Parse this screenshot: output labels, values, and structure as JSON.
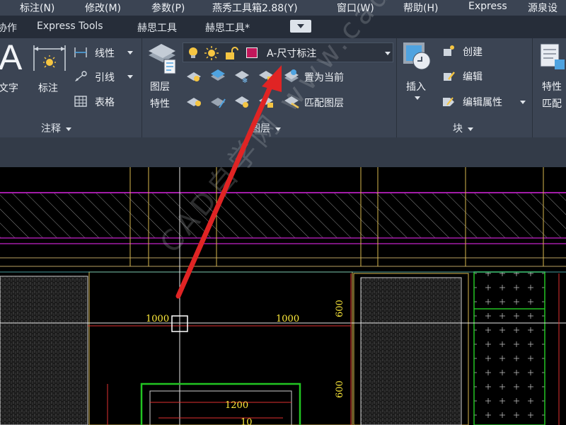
{
  "menubar": {
    "items": [
      "标注(N)",
      "修改(M)",
      "参数(P)",
      "燕秀工具箱2.88(Y)",
      "窗口(W)",
      "帮助(H)",
      "Express",
      "源泉设"
    ]
  },
  "ribbon_tabs": {
    "items": [
      "协作",
      "Express Tools",
      "赫思工具",
      "赫思工具*"
    ]
  },
  "annotation_panel": {
    "text_label": "文字",
    "dim_label": "标注",
    "linear_label": "线性",
    "leader_label": "引线",
    "table_label": "表格",
    "title": "注释"
  },
  "layers_panel": {
    "layer_props_label_1": "图层",
    "layer_props_label_2": "特性",
    "current_layer": "A-尺寸标注",
    "layer_color": "#c2185b",
    "set_current_label": "置为当前",
    "match_layer_label": "匹配图层",
    "title": "图层"
  },
  "block_panel": {
    "insert_label": "插入",
    "create_label": "创建",
    "edit_label": "编辑",
    "edit_attr_label": "编辑属性",
    "title": "块"
  },
  "properties_panel": {
    "label_1": "特性",
    "label_2": "匹配"
  },
  "drawing": {
    "dims": [
      "1000",
      "1000",
      "600",
      "600",
      "1200",
      "10"
    ],
    "watermark": "CAD自学网 www.cadzxw.com",
    "colors": {
      "yellow": "#d9b94e",
      "magenta": "#a21ca8",
      "red": "#e03030",
      "green": "#22c422",
      "cyan": "#5fd0d0"
    }
  }
}
